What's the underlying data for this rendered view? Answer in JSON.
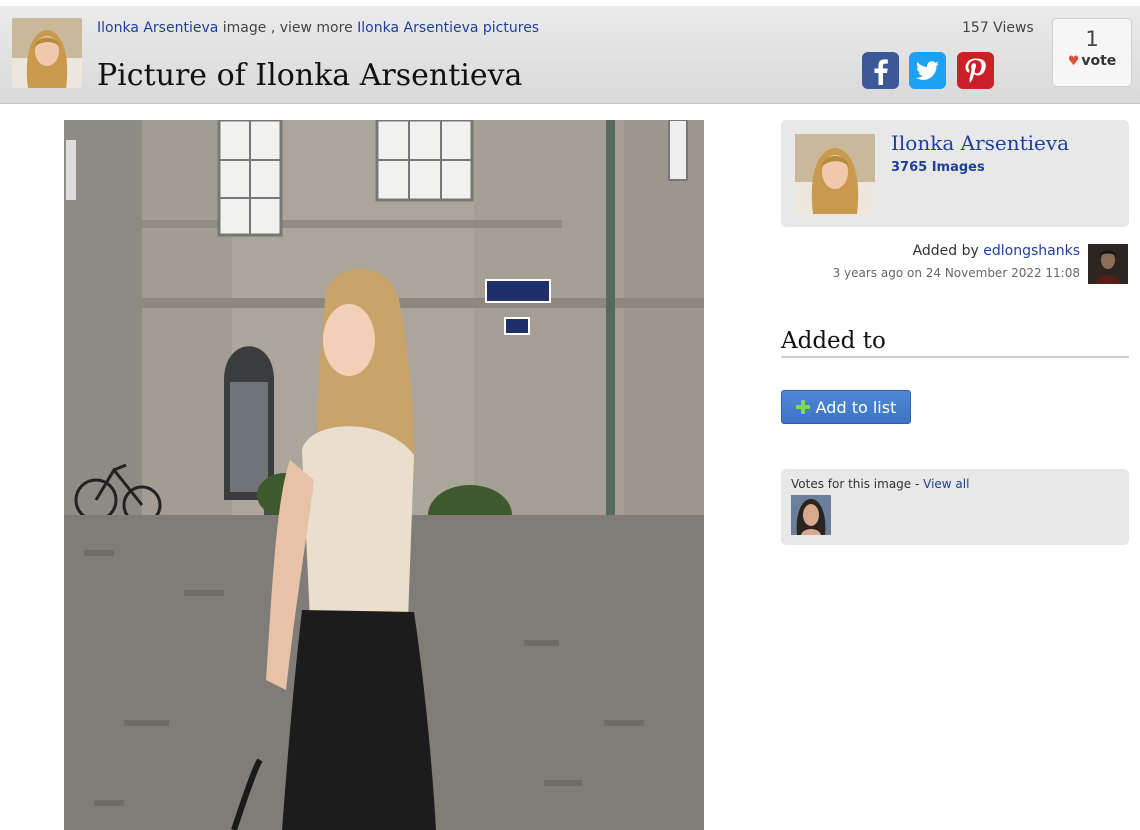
{
  "header": {
    "breadcrumb_link1": "Ilonka Arsentieva",
    "breadcrumb_mid": " image , view more ",
    "breadcrumb_link2": "Ilonka Arsentieva pictures",
    "title": "Picture of Ilonka Arsentieva",
    "views": "157 Views",
    "vote_count": "1",
    "vote_label": "vote"
  },
  "share": {
    "icons": [
      "facebook-icon",
      "twitter-icon",
      "pinterest-icon"
    ],
    "colors": {
      "facebook": "#3b5998",
      "twitter": "#1da1f2",
      "pinterest": "#cb2027"
    }
  },
  "sidebar": {
    "profile_name": "Ilonka Arsentieva",
    "profile_count": "3765 Images",
    "added_by_label": "Added by ",
    "added_by_user": "edlongshanks",
    "added_time": "3 years ago on 24 November 2022 11:08",
    "added_to_title": "Added to",
    "add_to_list_label": "Add to list",
    "votes_label": "Votes for this image - ",
    "votes_link": "View all"
  },
  "colors": {
    "link": "#1f3f9a",
    "button": "#3a73c3",
    "card": "#e8e8e8"
  }
}
